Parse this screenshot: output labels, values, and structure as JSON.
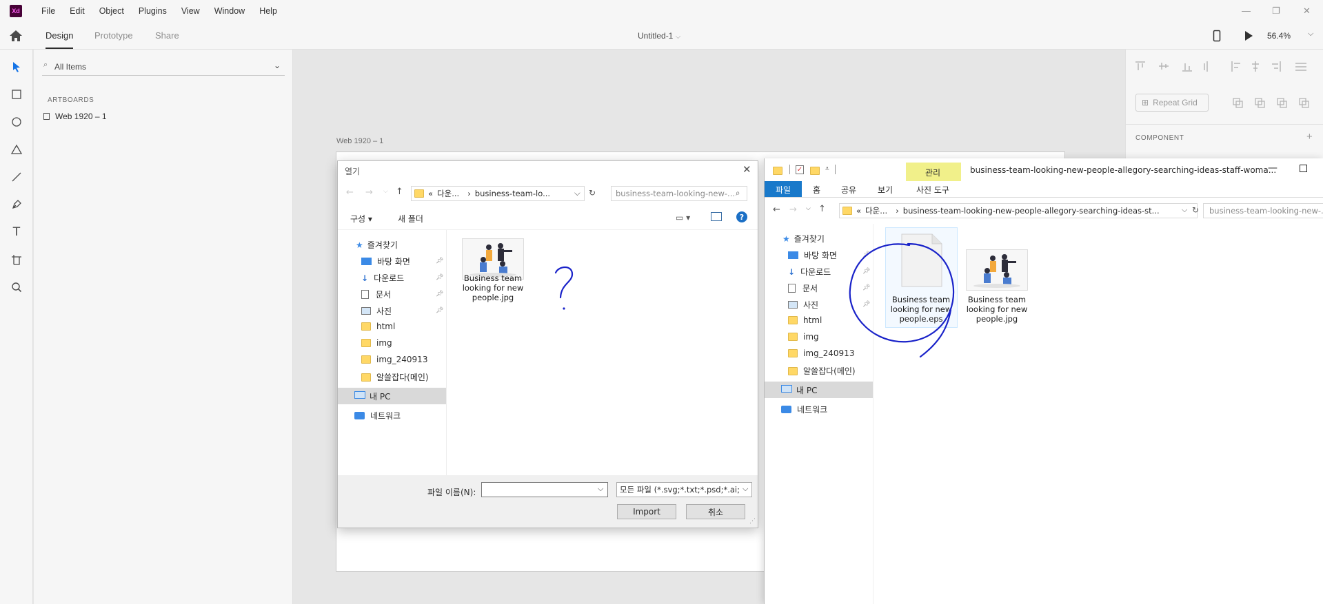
{
  "app": {
    "logo": "Xd",
    "menus": [
      "File",
      "Edit",
      "Object",
      "Plugins",
      "View",
      "Window",
      "Help"
    ],
    "modes": [
      "Design",
      "Prototype",
      "Share"
    ],
    "doc_title": "Untitled-1",
    "zoom": "56.4%"
  },
  "layers": {
    "search_placeholder": "All Items",
    "artboards_heading": "ARTBOARDS",
    "artboard_item": "Web 1920 – 1"
  },
  "canvas": {
    "artboard_label": "Web 1920 – 1"
  },
  "props": {
    "repeat_grid": "Repeat Grid",
    "component_heading": "COMPONENT"
  },
  "open_dialog": {
    "title": "열기",
    "address_prefix": "«",
    "address_part1": "다운...",
    "address_part2": "business-team-lo...",
    "search": "business-team-looking-new-...",
    "organize": "구성",
    "new_folder": "새 폴더",
    "nav": {
      "favorites": "즐겨찾기",
      "desktop": "바탕 화면",
      "downloads": "다운로드",
      "documents": "문서",
      "pictures": "사진",
      "html": "html",
      "img": "img",
      "img_240913": "img_240913",
      "alssul": "알쓸잡다(메인)",
      "this_pc": "내 PC",
      "network": "네트워크"
    },
    "file": {
      "caption_line1": "Business team",
      "caption_line2": "looking for new",
      "caption_line3": "people.jpg"
    },
    "annotation": "?",
    "filename_label": "파일 이름(N):",
    "filename_value": "",
    "filetype": "모든 파일 (*.svg;*.txt;*.psd;*.ai;",
    "import_btn": "Import",
    "cancel_btn": "취소"
  },
  "explorer": {
    "title": "business-team-looking-new-people-allegory-searching-ideas-staff-woma...",
    "manage_tab": "관리",
    "ribbon_tabs": [
      "파일",
      "홈",
      "공유",
      "보기",
      "사진 도구"
    ],
    "address_prefix": "«",
    "address_part1": "다운...",
    "address_part2": "business-team-looking-new-people-allegory-searching-ideas-st...",
    "search": "business-team-looking-new-...",
    "files": [
      {
        "line1": "Business team",
        "line2": "looking for new",
        "line3": "people.eps"
      },
      {
        "line1": "Business team",
        "line2": "looking for new",
        "line3": "people.jpg"
      }
    ]
  },
  "colors": {
    "xd_logo_bg": "#470137",
    "xd_logo_fg": "#ff61f6",
    "annotation_blue": "#1a23c9",
    "folder_yellow": "#ffd866",
    "ribbon_blue": "#1979ca",
    "manage_yellow": "#f1f08a"
  }
}
